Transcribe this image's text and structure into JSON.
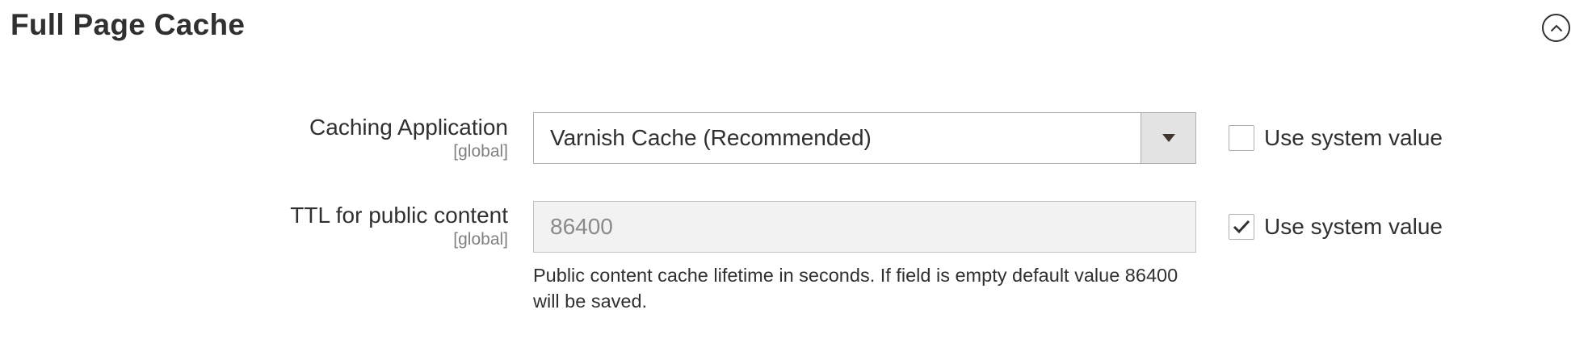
{
  "section": {
    "title": "Full Page Cache",
    "collapse_icon": "chevron-up-circle-icon"
  },
  "fields": [
    {
      "label": "Caching Application",
      "scope": "[global]",
      "type": "select",
      "value": "Varnish Cache (Recommended)",
      "dropdown_icon": "triangle-down-icon",
      "use_system_value": {
        "label": "Use system value",
        "checked": false
      }
    },
    {
      "label": "TTL for public content",
      "scope": "[global]",
      "type": "text",
      "value": "86400",
      "disabled": true,
      "note": "Public content cache lifetime in seconds. If field is empty default value 86400 will be saved.",
      "use_system_value": {
        "label": "Use system value",
        "checked": true
      }
    }
  ]
}
